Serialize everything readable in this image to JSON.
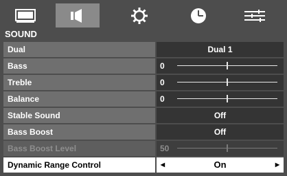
{
  "tabs": [
    {
      "icon": "picture-icon",
      "selected": false
    },
    {
      "icon": "speaker-icon",
      "selected": true
    },
    {
      "icon": "gear-icon",
      "selected": false
    },
    {
      "icon": "clock-icon",
      "selected": false
    },
    {
      "icon": "sliders-icon",
      "selected": false
    }
  ],
  "section": {
    "title": "SOUND"
  },
  "rows": [
    {
      "label": "Dual",
      "value": "Dual 1",
      "type": "option"
    },
    {
      "label": "Bass",
      "value": "0",
      "type": "slider",
      "level": 0.5
    },
    {
      "label": "Treble",
      "value": "0",
      "type": "slider",
      "level": 0.5
    },
    {
      "label": "Balance",
      "value": "0",
      "type": "slider",
      "level": 0.5
    },
    {
      "label": "Stable Sound",
      "value": "Off",
      "type": "option"
    },
    {
      "label": "Bass Boost",
      "value": "Off",
      "type": "option"
    },
    {
      "label": "Bass Boost Level",
      "value": "50",
      "type": "slider",
      "level": 0.5,
      "disabled": true
    },
    {
      "label": "Dynamic Range Control",
      "value": "On",
      "type": "option",
      "selected": true
    }
  ],
  "colors": {
    "background": "#4d4d4d",
    "label_cell": "#6f6f6f",
    "value_cell": "#343434",
    "selected_tab": "#8a8a8a",
    "selected_row": "#ffffff",
    "disabled_text": "#8e8e8e"
  }
}
